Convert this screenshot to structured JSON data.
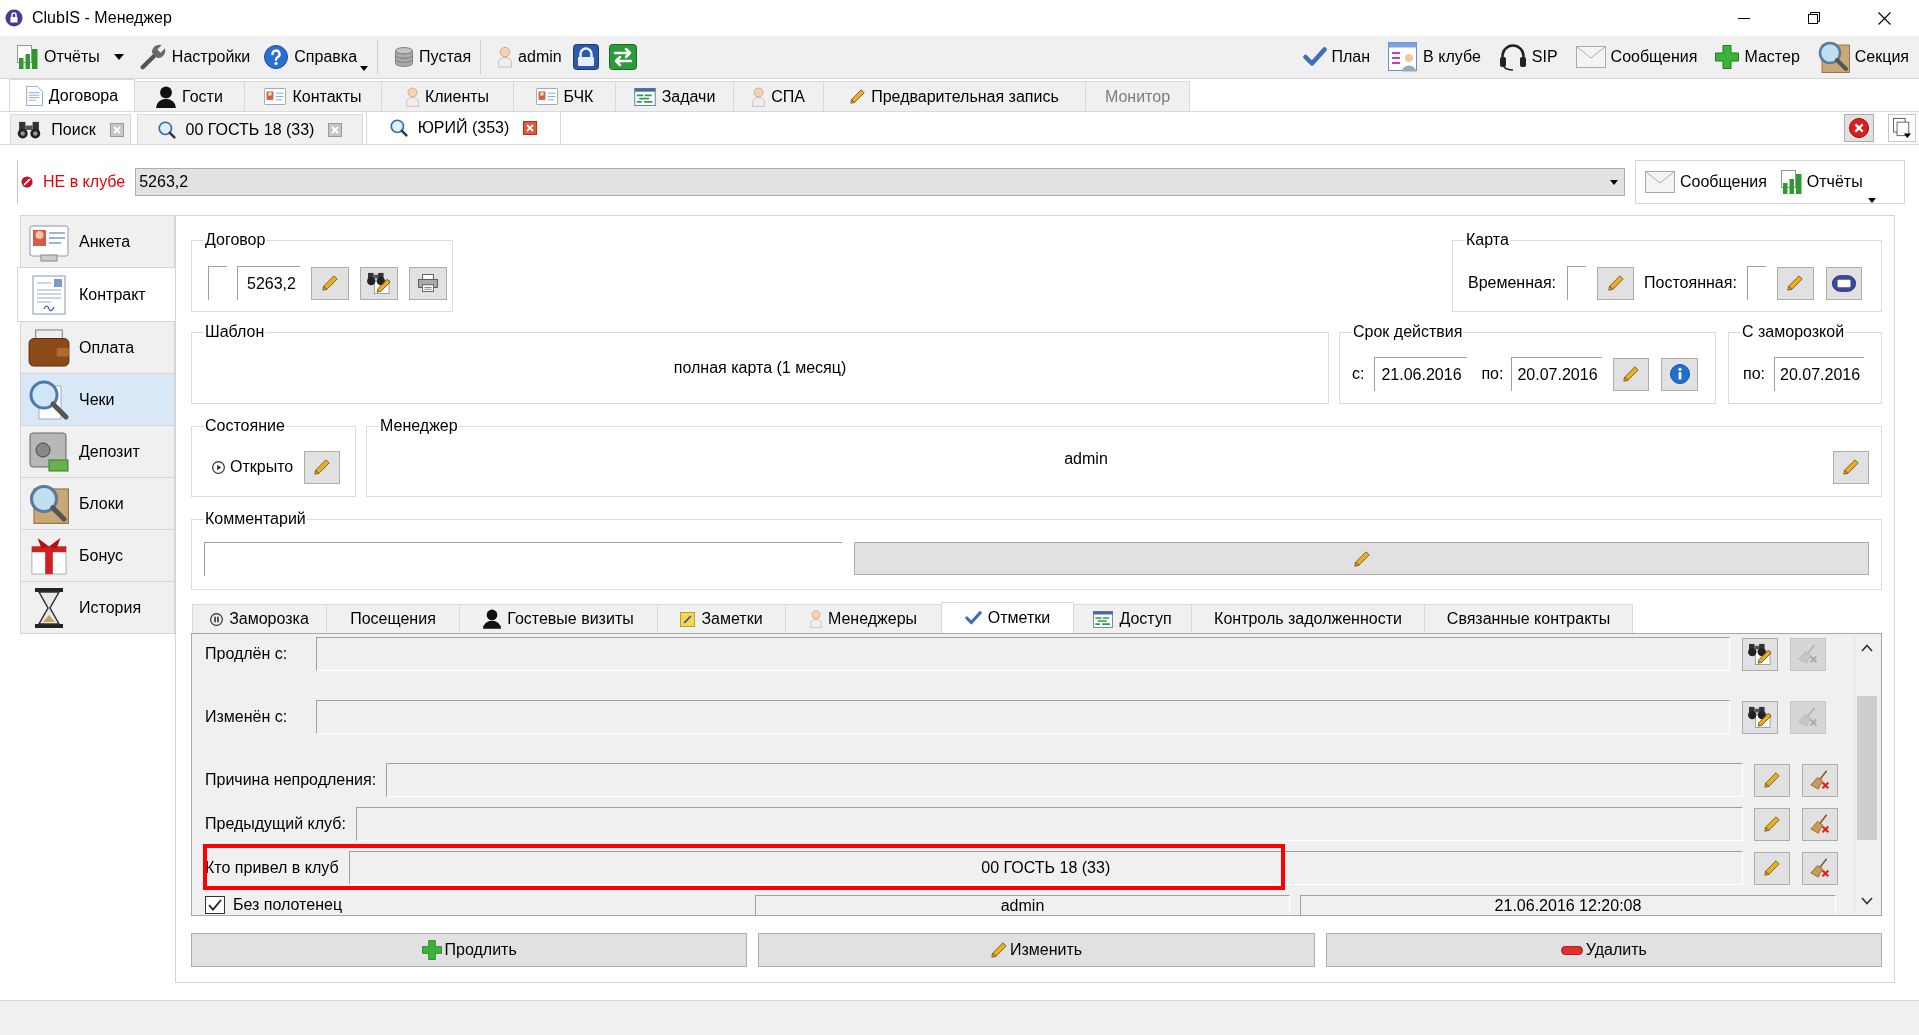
{
  "window": {
    "title": "ClubIS - Менеджер"
  },
  "toolbar": {
    "left": [
      {
        "kind": "split",
        "label": "Отчёты"
      },
      {
        "kind": "button",
        "label": "Настройки"
      },
      {
        "kind": "menu",
        "label": "Справка"
      },
      {
        "kind": "separator"
      },
      {
        "kind": "button",
        "label": "Пустая"
      },
      {
        "kind": "separator"
      },
      {
        "kind": "button",
        "label": "admin"
      },
      {
        "kind": "icon_button"
      },
      {
        "kind": "icon_button"
      }
    ],
    "right": [
      {
        "label": "План"
      },
      {
        "label": "В клубе"
      },
      {
        "label": "SIP"
      },
      {
        "label": "Сообщения"
      },
      {
        "label": "Мастер"
      },
      {
        "label": "Секция"
      }
    ]
  },
  "main_tabs": [
    {
      "label": "Договора",
      "selected": true,
      "disabled": false
    },
    {
      "label": "Гости",
      "selected": false,
      "disabled": false
    },
    {
      "label": "Контакты",
      "selected": false,
      "disabled": false
    },
    {
      "label": "Клиенты",
      "selected": false,
      "disabled": false
    },
    {
      "label": "БЧК",
      "selected": false,
      "disabled": false
    },
    {
      "label": "Задачи",
      "selected": false,
      "disabled": false
    },
    {
      "label": "СПА",
      "selected": false,
      "disabled": false
    },
    {
      "label": "Предварительная запись",
      "selected": false,
      "disabled": false
    },
    {
      "label": "Монитор",
      "selected": false,
      "disabled": true
    }
  ],
  "document_tabs": [
    {
      "label": "Поиск",
      "selected": false
    },
    {
      "label": "00 ГОСТЬ 18 (33)",
      "selected": false
    },
    {
      "label": "ЮРИЙ (353)",
      "selected": true
    }
  ],
  "client_bar": {
    "status": "НЕ в клубе",
    "in_club": false,
    "contract": "5263,2",
    "buttons": [
      {
        "kind": "button",
        "label": "Сообщения"
      },
      {
        "kind": "menu",
        "label": "Отчёты"
      }
    ]
  },
  "sidebar": {
    "items": [
      {
        "label": "Анкета",
        "selected": false,
        "highlighted": false
      },
      {
        "label": "Контракт",
        "selected": true,
        "highlighted": false
      },
      {
        "label": "Оплата",
        "selected": false,
        "highlighted": false
      },
      {
        "label": "Чеки",
        "selected": false,
        "highlighted": true
      },
      {
        "label": "Депозит",
        "selected": false,
        "highlighted": false
      },
      {
        "label": "Блоки",
        "selected": false,
        "highlighted": false
      },
      {
        "label": "Бонус",
        "selected": false,
        "highlighted": false
      },
      {
        "label": "История",
        "selected": false,
        "highlighted": false
      }
    ]
  },
  "contract": {
    "title": "Договор",
    "number": "5263,2"
  },
  "card": {
    "title": "Карта",
    "temporary_label": "Временная:",
    "permanent_label": "Постоянная:"
  },
  "template": {
    "title": "Шаблон",
    "value": "полная карта (1 месяц)"
  },
  "validity": {
    "title": "Срок действия",
    "from_label": "с:",
    "from": "21.06.2016",
    "to_label": "по:",
    "to": "20.07.2016"
  },
  "freeze": {
    "title": "С заморозкой",
    "to_label": "по:",
    "to": "20.07.2016"
  },
  "state": {
    "title": "Состояние",
    "value": "Открыто"
  },
  "manager": {
    "title": "Менеджер",
    "value": "admin"
  },
  "comment": {
    "title": "Комментарий"
  },
  "detail_tabs": [
    {
      "label": "Заморозка",
      "selected": false
    },
    {
      "label": "Посещения",
      "selected": false
    },
    {
      "label": "Гостевые визиты",
      "selected": false
    },
    {
      "label": "Заметки",
      "selected": false
    },
    {
      "label": "Менеджеры",
      "selected": false
    },
    {
      "label": "Отметки",
      "selected": true
    },
    {
      "label": "Доступ",
      "selected": false
    },
    {
      "label": "Контроль задолженности",
      "selected": false
    },
    {
      "label": "Связанные контракты",
      "selected": false
    }
  ],
  "marks": {
    "rows": [
      {
        "kind": "lookup",
        "label": "Продлён с:",
        "clear_disabled": true,
        "highlighted": false
      },
      {
        "kind": "lookup",
        "label": "Изменён с:",
        "clear_disabled": true,
        "highlighted": false
      },
      {
        "kind": "edit",
        "label": "Причина непродления:",
        "clear_disabled": false,
        "highlighted": false
      },
      {
        "kind": "edit",
        "label": "Предыдущий клуб:",
        "clear_disabled": false,
        "highlighted": false
      },
      {
        "kind": "edit",
        "label": "Кто привел в клуб",
        "value": "00 ГОСТЬ 18 (33)",
        "clear_disabled": false,
        "highlighted": true
      },
      {
        "kind": "check",
        "label": "Без полотенец",
        "checked": true,
        "user": "admin",
        "time": "21.06.2016 12:20:08",
        "highlighted": false
      }
    ]
  },
  "actions": [
    {
      "label": "Продлить"
    },
    {
      "label": "Изменить"
    },
    {
      "label": "Удалить"
    }
  ]
}
